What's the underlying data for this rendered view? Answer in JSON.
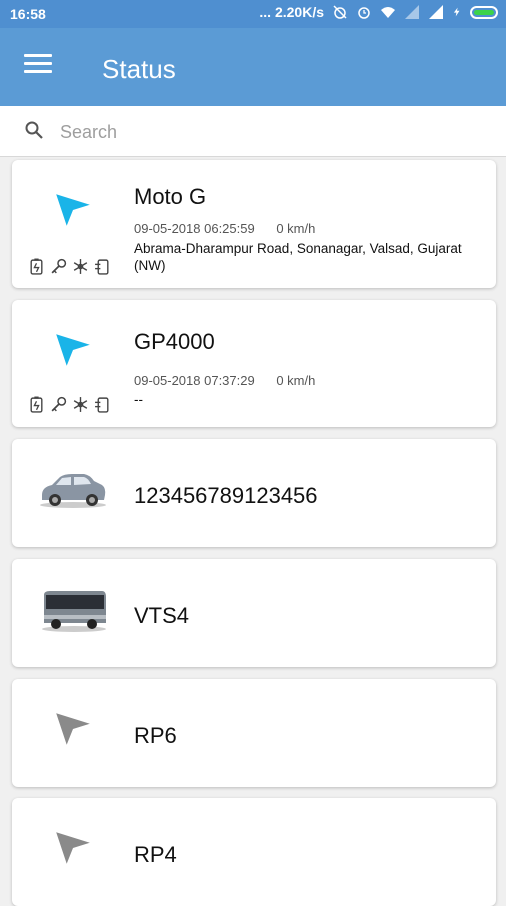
{
  "status_bar": {
    "time": "16:58",
    "network_speed": "... 2.20K/s"
  },
  "app_bar": {
    "title": "Status"
  },
  "search": {
    "placeholder": "Search"
  },
  "devices": [
    {
      "name": "Moto G",
      "date": "09-05-2018 06:25:59",
      "speed": "0 km/h",
      "address": "Abrama-Dharampur Road, Sonanagar, Valsad, Gujarat (NW)",
      "icon": "navigation-arrow-cyan"
    },
    {
      "name": "GP4000",
      "date": "09-05-2018 07:37:29",
      "speed": "0 km/h",
      "address": "--",
      "icon": "navigation-arrow-cyan"
    },
    {
      "name": "123456789123456",
      "icon": "car"
    },
    {
      "name": "VTS4",
      "icon": "bus"
    },
    {
      "name": "RP6",
      "icon": "navigation-arrow-grey"
    },
    {
      "name": "RP4",
      "icon": "navigation-arrow-grey"
    }
  ],
  "colors": {
    "app_bar": "#5b9bd5",
    "status_bar": "#4f8fd0",
    "active_arrow": "#1ab4e8",
    "inactive_arrow": "#8a8a8a"
  }
}
